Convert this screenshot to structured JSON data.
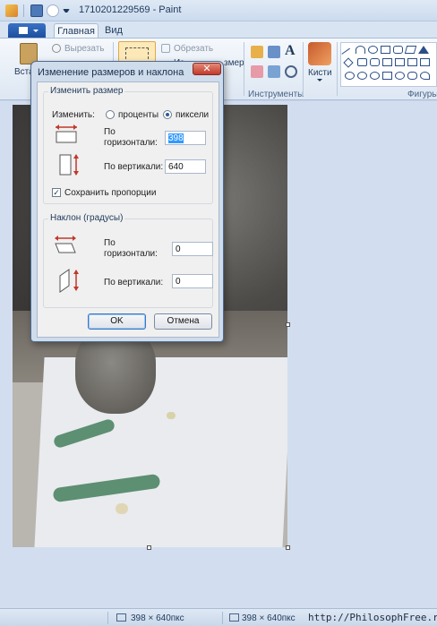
{
  "window": {
    "title": "1710201229569 - Paint"
  },
  "ribbon": {
    "tabs": [
      {
        "label": "Главная",
        "active": true
      },
      {
        "label": "Вид",
        "active": false
      }
    ],
    "clipboard": {
      "paste_label": "Вста",
      "cut_label": "Вырезать"
    },
    "image": {
      "crop_label": "Обрезать",
      "resize_partial": "Из",
      "rotate_partial": "змер"
    },
    "tools_label": "Инструменты",
    "brushes_label": "Кисти",
    "shapes_label": "Фигуры"
  },
  "dialog": {
    "title": "Изменение размеров и наклона",
    "close_glyph": "✕",
    "resize": {
      "legend": "Изменить размер",
      "by_label": "Изменить:",
      "option_percent": "проценты",
      "option_pixels": "пиксели",
      "selected": "pixels",
      "horizontal_label_1": "По",
      "horizontal_label_2": "горизонтали:",
      "horizontal_value": "398",
      "vertical_label": "По вертикали:",
      "vertical_value": "640",
      "keep_ratio_label": "Сохранить пропорции",
      "keep_ratio_checked": true
    },
    "skew": {
      "legend": "Наклон (градусы)",
      "horizontal_label_1": "По",
      "horizontal_label_2": "горизонтали:",
      "horizontal_value": "0",
      "vertical_label": "По вертикали:",
      "vertical_value": "0"
    },
    "ok_label": "OK",
    "cancel_label": "Отмена"
  },
  "statusbar": {
    "size_1": "398 × 640пкс",
    "size_2": "398 × 640пкс"
  },
  "watermark": "http://PhilosophFree.ru/",
  "colors": {
    "ribbon_blue": "#1c4f9e",
    "close_red": "#c0392b",
    "selection_blue": "#3399ff"
  }
}
